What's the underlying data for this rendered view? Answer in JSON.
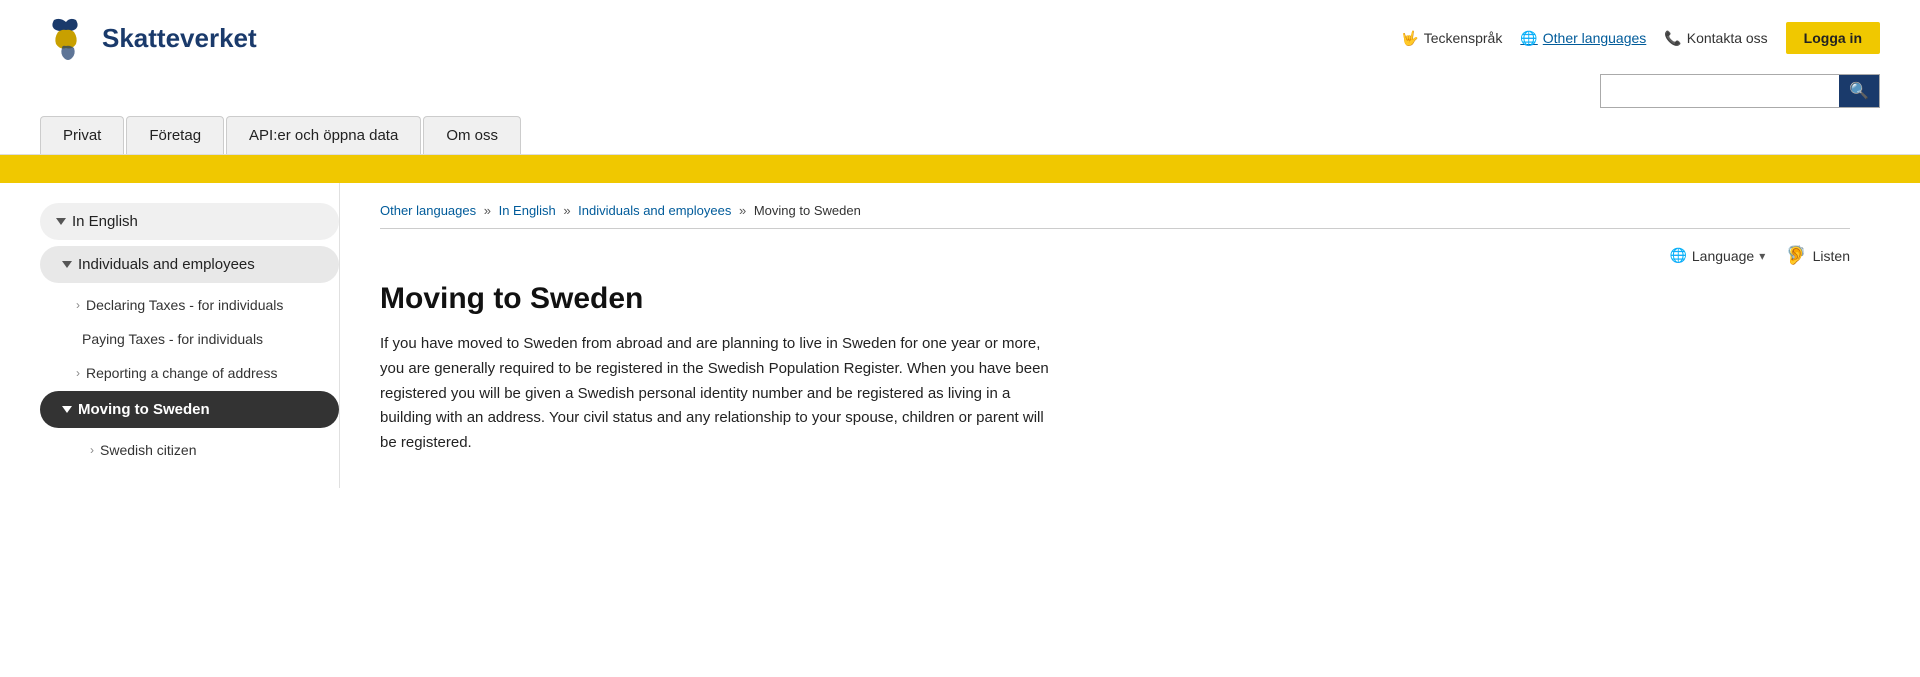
{
  "header": {
    "logo_text": "Skatteverket",
    "actions": {
      "sign_language": "Teckenspråk",
      "other_languages": "Other languages",
      "contact": "Kontakta oss",
      "login": "Logga in"
    },
    "search_placeholder": "",
    "nav_tabs": [
      "Privat",
      "Företag",
      "API:er och öppna data",
      "Om oss"
    ]
  },
  "sidebar": {
    "items": [
      {
        "label": "In English",
        "type": "section",
        "expanded": true
      },
      {
        "label": "Individuals and employees",
        "type": "subsection",
        "expanded": true
      },
      {
        "label": "Declaring Taxes - for individuals",
        "type": "leaf"
      },
      {
        "label": "Paying Taxes - for individuals",
        "type": "leaf"
      },
      {
        "label": "Reporting a change of address",
        "type": "leaf"
      },
      {
        "label": "Moving to Sweden",
        "type": "leaf-active"
      },
      {
        "label": "Swedish citizen",
        "type": "sub-leaf"
      }
    ]
  },
  "breadcrumb": {
    "items": [
      {
        "label": "Other languages",
        "link": true
      },
      {
        "label": "In English",
        "link": true
      },
      {
        "label": "Individuals and employees",
        "link": true
      },
      {
        "label": "Moving to Sweden",
        "link": false
      }
    ]
  },
  "content": {
    "tools": {
      "language": "Language",
      "listen": "Listen"
    },
    "title": "Moving to Sweden",
    "body": "If you have moved to Sweden from abroad and are planning to live in Sweden for one year or more, you are generally required to be registered in the Swedish Population Register. When you have been registered you will be given a Swedish personal identity number and be registered as living in a building with an address. Your civil status and any relationship to your spouse, children or parent will be registered."
  }
}
